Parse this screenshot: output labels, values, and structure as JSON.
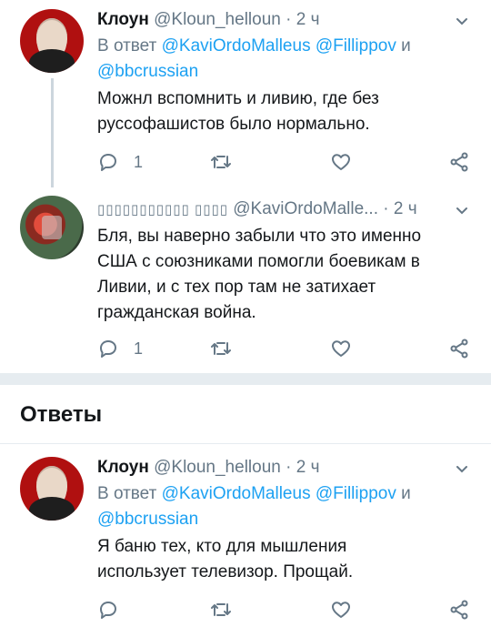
{
  "tweets": [
    {
      "name": "Клоун",
      "handle": "@Kloun_helloun",
      "time": "2 ч",
      "reply_prefix": "В ответ",
      "reply_mentions_1": "@KaviOrdoMalleus @Fillippov",
      "reply_and": "и",
      "reply_mentions_2": "@bbcrussian",
      "text_line1": "Можнл вспомнить и ливию, где без",
      "text_line2": "руссофашистов было нормально.",
      "reply_count": "1"
    },
    {
      "name": "▯▯▯▯▯▯▯▯▯▯▯ ▯▯▯▯",
      "handle": "@KaviOrdoMalle...",
      "time": "2 ч",
      "text_line1": "Бля, вы наверно забыли что это именно",
      "text_line2": "США с союзниками помогли боевикам в",
      "text_line3": "Ливии, и с тех пор там не затихает",
      "text_line4": "гражданская война.",
      "reply_count": "1"
    },
    {
      "name": "Клоун",
      "handle": "@Kloun_helloun",
      "time": "2 ч",
      "reply_prefix": "В ответ",
      "reply_mentions_1": "@KaviOrdoMalleus @Fillippov",
      "reply_and": "и",
      "reply_mentions_2": "@bbcrussian",
      "text_line1": "Я баню тех, кто для мышления",
      "text_line2": "использует телевизор. Прощай."
    }
  ],
  "replies_heading": "Ответы",
  "colors": {
    "link": "#1da1f2",
    "muted": "#657786",
    "separator": "#e6ecf0"
  },
  "icons": [
    "reply-icon",
    "retweet-icon",
    "like-icon",
    "share-icon",
    "chevron-down-icon"
  ]
}
